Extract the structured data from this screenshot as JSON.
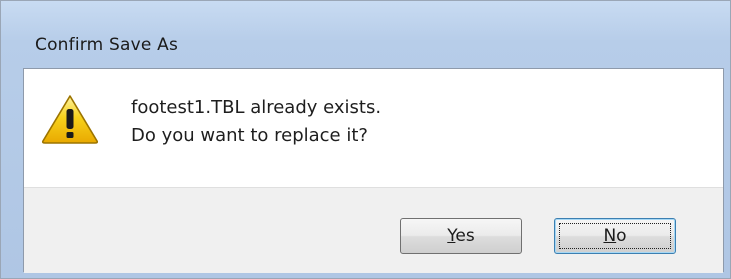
{
  "dialog": {
    "title": "Confirm Save As",
    "icon": "warning-icon",
    "message_line1": "footest1.TBL already exists.",
    "message_line2": "Do you want to replace it?"
  },
  "buttons": {
    "yes": {
      "accel": "Y",
      "rest": "es"
    },
    "no": {
      "accel": "N",
      "rest": "o"
    }
  },
  "colors": {
    "titlebar": "#b7cde9",
    "warning_fill": "#f5c400",
    "button_area": "#f0f0f0"
  }
}
